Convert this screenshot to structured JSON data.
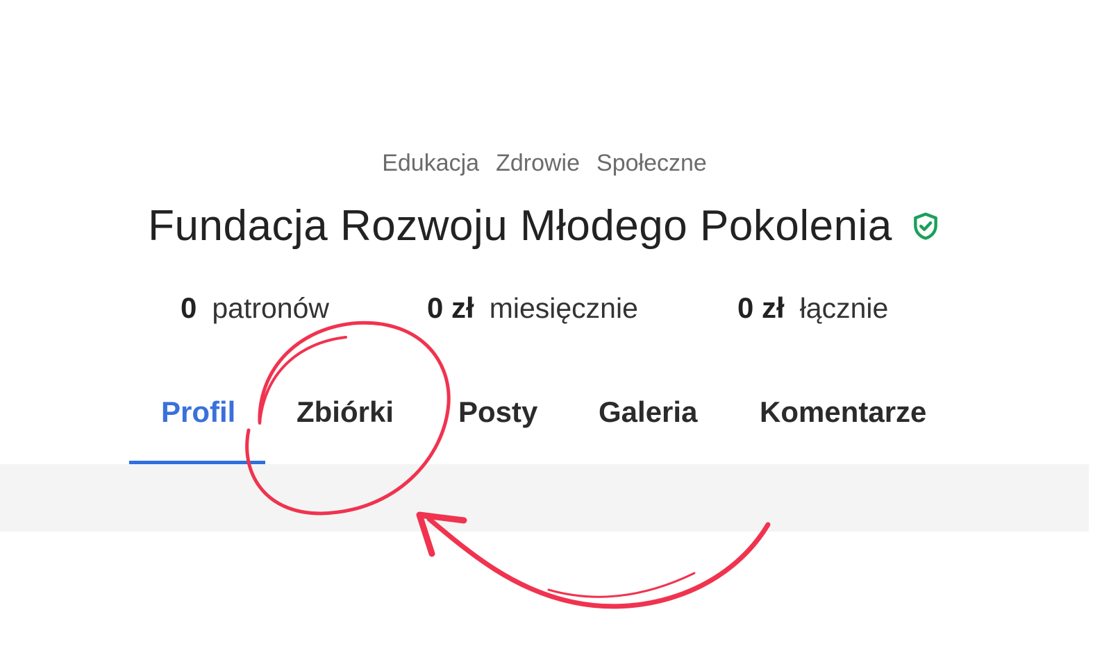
{
  "tags": [
    "Edukacja",
    "Zdrowie",
    "Społeczne"
  ],
  "title": "Fundacja Rozwoju Młodego Pokolenia",
  "verified_icon": "shield-check-icon",
  "stats": [
    {
      "value": "0",
      "label": "patronów"
    },
    {
      "value": "0 zł",
      "label": "miesięcznie"
    },
    {
      "value": "0 zł",
      "label": "łącznie"
    }
  ],
  "tabs": [
    {
      "label": "Profil",
      "active": true
    },
    {
      "label": "Zbiórki",
      "active": false
    },
    {
      "label": "Posty",
      "active": false
    },
    {
      "label": "Galeria",
      "active": false
    },
    {
      "label": "Komentarze",
      "active": false
    }
  ],
  "colors": {
    "accent": "#2f6fe0",
    "verified": "#1aa05a",
    "annotation": "#f0334f"
  }
}
